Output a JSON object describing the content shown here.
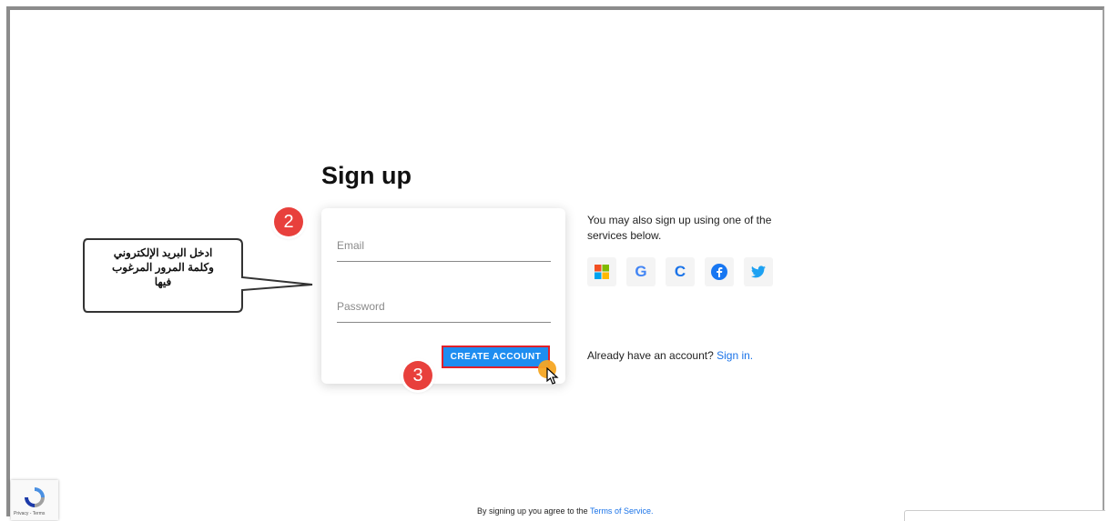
{
  "page": {
    "title": "Sign up",
    "email_placeholder": "Email",
    "password_placeholder": "Password",
    "create_button": "CREATE ACCOUNT",
    "side_text": "You may also sign up using one of the services below.",
    "already_text": "Already have an account?",
    "sign_in_link": "Sign in.",
    "terms_text": "By signing up you agree to the",
    "terms_link": "Terms of Service."
  },
  "social": [
    {
      "name": "microsoft-icon"
    },
    {
      "name": "google-icon",
      "glyph": "G",
      "color": "#4285f4"
    },
    {
      "name": "c-icon",
      "glyph": "C",
      "color": "#1a73e8"
    },
    {
      "name": "facebook-icon",
      "color": "#1877f2"
    },
    {
      "name": "twitter-icon",
      "color": "#1da1f2"
    }
  ],
  "annotations": {
    "badge_2": "2",
    "badge_3": "3",
    "callout_line1": "ادخل البريد الإلكتروني",
    "callout_line2": "وكلمة المرور المرغوب",
    "callout_line3": "فيها"
  },
  "recaptcha": {
    "text": "Privacy - Terms"
  },
  "colors": {
    "accent": "#1e8df0",
    "highlight": "#e0202a",
    "badge": "#e8403c",
    "cursor": "#f5a623"
  }
}
